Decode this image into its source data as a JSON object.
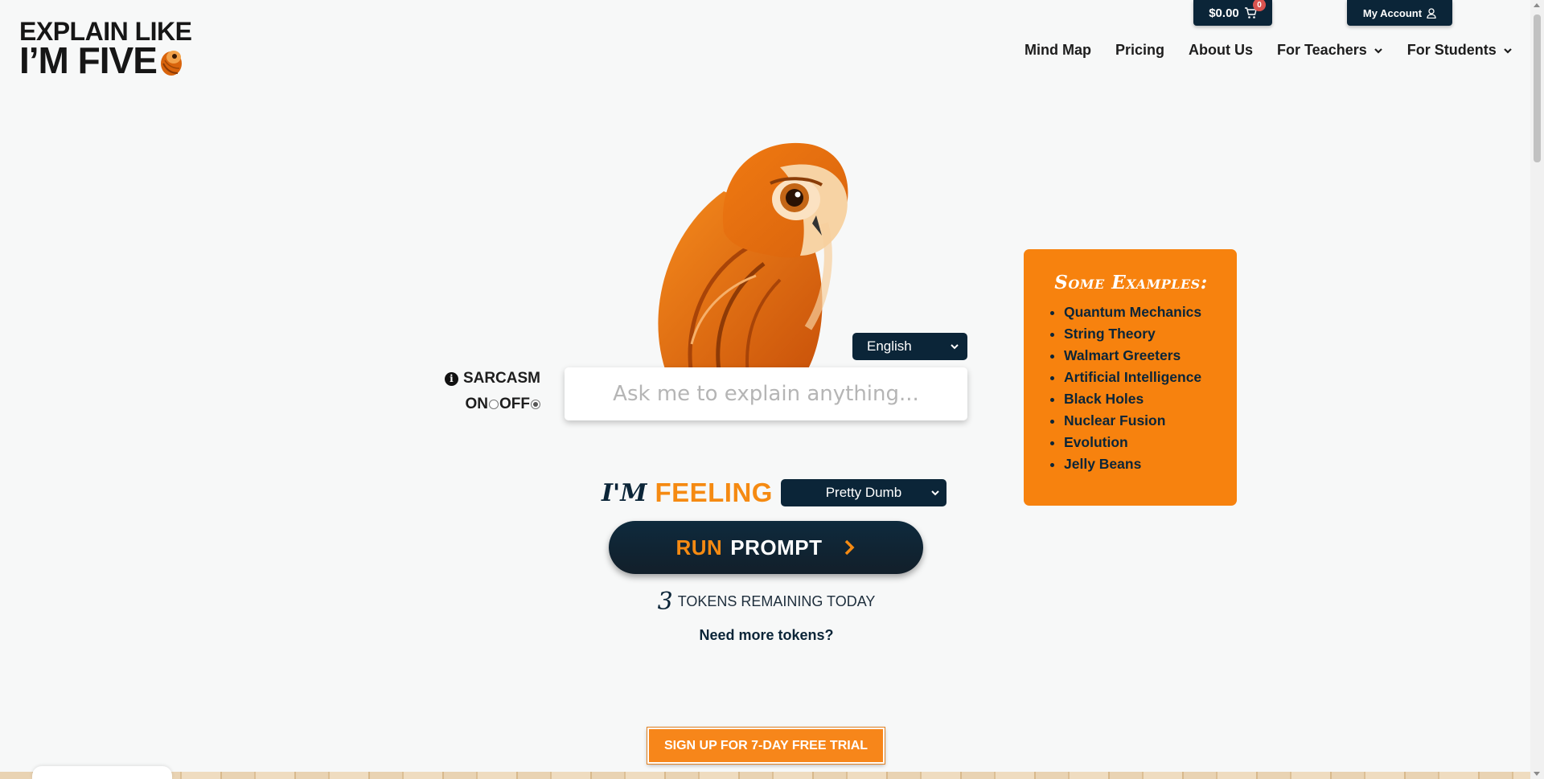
{
  "logo": {
    "line1": "EXPLAIN LIKE",
    "line2": "I’M FIVE"
  },
  "cart": {
    "amount": "$0.00",
    "count": "0"
  },
  "account": {
    "label": "My Account"
  },
  "nav": {
    "items": [
      {
        "label": "Mind Map"
      },
      {
        "label": "Pricing"
      },
      {
        "label": "About Us"
      },
      {
        "label": "For Teachers"
      },
      {
        "label": "For Students"
      }
    ]
  },
  "language": {
    "selected": "English"
  },
  "sarcasm": {
    "label": "SARCASM",
    "on": "ON",
    "off": "OFF",
    "value": "OFF"
  },
  "ask": {
    "placeholder": "Ask me to explain anything..."
  },
  "feeling": {
    "im": "I'M",
    "feeling": "FEELING",
    "selected": "Pretty Dumb"
  },
  "run": {
    "run": "RUN",
    "prompt": "PROMPT"
  },
  "tokens": {
    "count": "3",
    "label": "TOKENS REMAINING TODAY",
    "more": "Need more tokens?"
  },
  "signup": {
    "label": "SIGN UP FOR 7-DAY FREE TRIAL"
  },
  "examples": {
    "title": "Some Examples:",
    "items": [
      "Quantum Mechanics",
      "String Theory",
      "Walmart Greeters",
      "Artificial Intelligence",
      "Black Holes",
      "Nuclear Fusion",
      "Evolution",
      "Jelly Beans"
    ]
  },
  "colors": {
    "navy": "#0b2538",
    "orange": "#f7820e"
  }
}
